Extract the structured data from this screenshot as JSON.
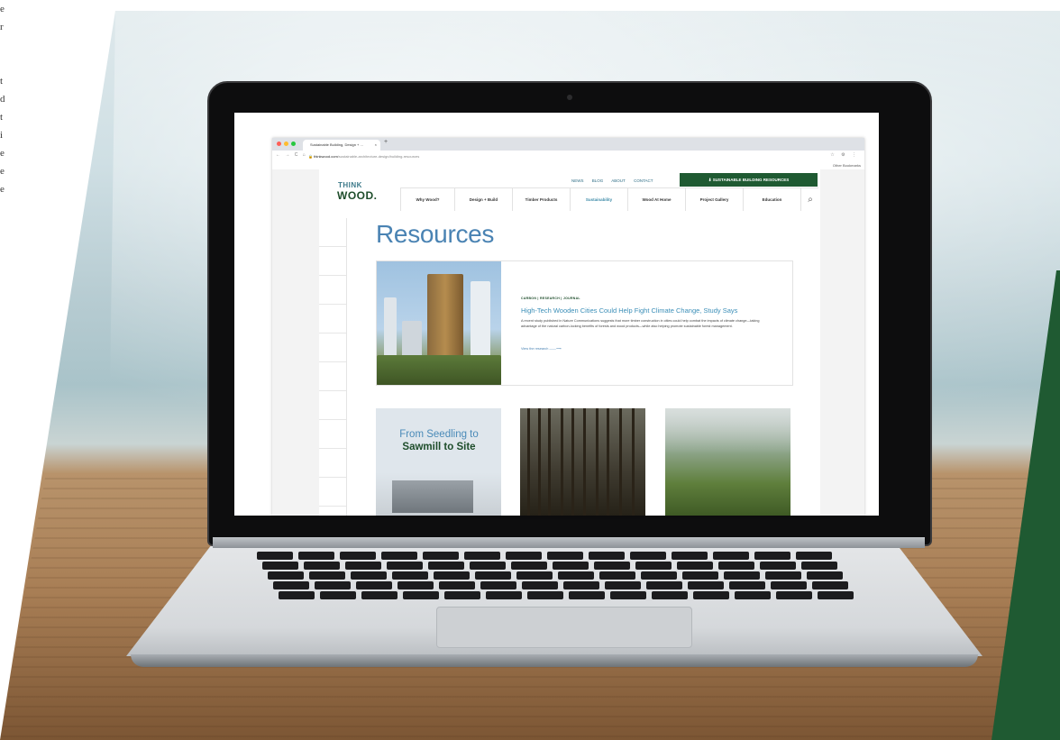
{
  "left_edge_letters": [
    "e",
    "r",
    "",
    "",
    "t",
    "d",
    "t",
    "i",
    "e",
    "e",
    "e"
  ],
  "browser": {
    "tab_title": "Sustainable Building, Design + ...",
    "tab_close": "×",
    "new_tab": "+",
    "nav_icons": "← → C ⌂",
    "url_domain": "thinkwood.com",
    "url_path": "/sustainable-architecture-design/building-resources",
    "right_icons": "☆ ⚙ ⋮",
    "other_bookmarks": "Other Bookmarks"
  },
  "site": {
    "logo_top": "THINK",
    "logo_bottom": "WOOD.",
    "top_links": [
      "NEWS",
      "BLOG",
      "ABOUT",
      "CONTACT"
    ],
    "cta": "⬇ SUSTAINABLE BUILDING RESOURCES",
    "main_nav": [
      "Why Wood?",
      "Design + Build",
      "Timber Products",
      "Sustainability",
      "Wood At Home",
      "Project Gallery",
      "Education"
    ],
    "active_nav": "Sustainability",
    "search_glyph": "⌕",
    "page_title": "Resources",
    "feature": {
      "meta": "CARBON | RESEARCH | JOURNAL",
      "headline": "High-Tech Wooden Cities Could Help Fight Climate Change, Study Says",
      "excerpt": "A recent study published in Nature Communications suggests that more timber construction in cities could help combat the impacts of climate change—taking advantage of the natural carbon-locking benefits of forests and wood products—while also helping promote sustainable forest management.",
      "read_more": "View the research ——⟶"
    },
    "cards": [
      {
        "line1": "From Seedling to",
        "line2": "Sawmill to Site"
      },
      {
        "caption": ""
      },
      {
        "caption": ""
      }
    ]
  },
  "colors": {
    "brand_green": "#1f5a32",
    "link_blue": "#4a83b3",
    "accent_teal": "#3c8aa8"
  }
}
